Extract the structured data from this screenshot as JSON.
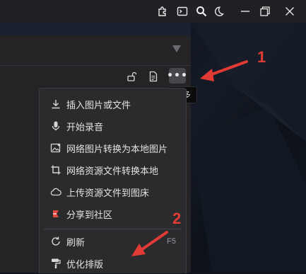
{
  "titlebar": {
    "icons": [
      "puzzle-icon",
      "terminal-icon",
      "search-icon",
      "moon-icon",
      "minimize-icon",
      "restore-icon",
      "close-icon"
    ]
  },
  "toolbar": {
    "icons": [
      "unlock-icon",
      "document-icon"
    ],
    "more_label": "•••",
    "tooltip": "更多"
  },
  "menu": {
    "items": [
      {
        "label": "插入图片或文件",
        "icon": "download-icon"
      },
      {
        "label": "开始录音",
        "icon": "microphone-icon"
      },
      {
        "label": "网络图片转换为本地图片",
        "icon": "image-convert-icon"
      },
      {
        "label": "网络资源文件转换本地",
        "icon": "crop-icon"
      },
      {
        "label": "上传资源文件到图床",
        "icon": "cloud-icon"
      },
      {
        "label": "分享到社区",
        "icon": "share-community-icon"
      },
      {
        "label": "刷新",
        "icon": "refresh-icon",
        "shortcut": "F5"
      },
      {
        "label": "优化排版",
        "icon": "paint-roller-icon"
      }
    ]
  },
  "annotations": {
    "marker_1": "1",
    "marker_2": "2",
    "color": "#e23a35"
  },
  "colors": {
    "panel": "#242427",
    "menu": "#2b2b2e",
    "titlebar": "#202124",
    "accent_red": "#e23a35"
  }
}
